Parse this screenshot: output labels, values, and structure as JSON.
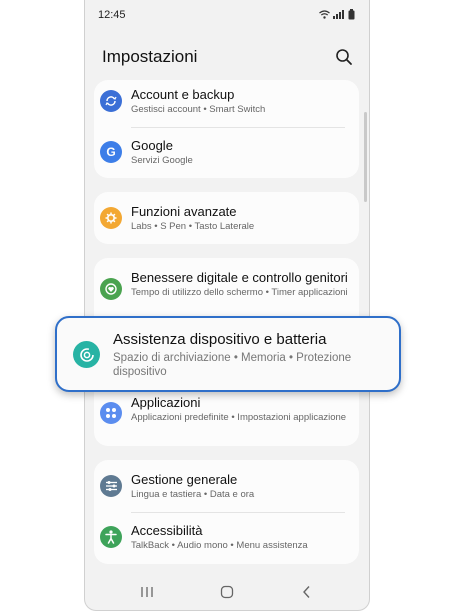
{
  "status_bar": {
    "time": "12:45"
  },
  "header": {
    "title": "Impostazioni"
  },
  "items": [
    {
      "title": "Account e backup",
      "subtitle": "Gestisci account  •  Smart Switch",
      "icon": "sync-icon",
      "color": "#3b6fd6"
    },
    {
      "title": "Google",
      "subtitle": "Servizi Google",
      "icon": "google-icon",
      "color": "#3d7ee8"
    },
    {
      "title": "Funzioni avanzate",
      "subtitle": "Labs  •  S Pen  •  Tasto Laterale",
      "icon": "gear-plus-icon",
      "color": "#f3a833"
    },
    {
      "title": "Benessere digitale e controllo genitori",
      "subtitle": "Tempo di utilizzo dello schermo  •  Timer applicazioni",
      "icon": "heart-timer-icon",
      "color": "#4aa34f"
    },
    {
      "title": "Assistenza dispositivo e batteria",
      "subtitle": "Spazio di archiviazione  •  Memoria  •  Protezione dispositivo",
      "icon": "device-care-icon",
      "color": "#27b3a4"
    },
    {
      "title": "Applicazioni",
      "subtitle": "Applicazioni predefinite  •  Impostazioni applicazione",
      "icon": "apps-grid-icon",
      "color": "#5b8def"
    },
    {
      "title": "Gestione generale",
      "subtitle": "Lingua e tastiera  •  Data e ora",
      "icon": "sliders-icon",
      "color": "#5f7a92"
    },
    {
      "title": "Accessibilità",
      "subtitle": "TalkBack  •  Audio mono  •  Menu assistenza",
      "icon": "accessibility-icon",
      "color": "#3ea35a"
    }
  ],
  "nav": {
    "recent": "recent-apps-icon",
    "home": "home-icon",
    "back": "back-icon"
  },
  "accent": "#2f6fc9"
}
